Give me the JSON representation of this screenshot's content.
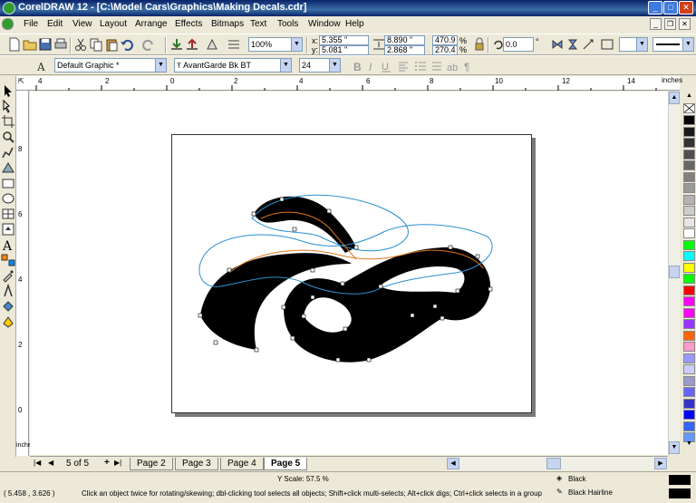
{
  "window": {
    "title": "CorelDRAW 12 - [C:\\Model Cars\\Graphics\\Making Decals.cdr]",
    "controls": [
      "minimize-icon",
      "maximize-icon",
      "close-icon"
    ]
  },
  "menu": {
    "items": [
      "File",
      "Edit",
      "View",
      "Layout",
      "Arrange",
      "Effects",
      "Bitmaps",
      "Text",
      "Tools",
      "Window",
      "Help"
    ]
  },
  "toolbar": {
    "zoom": "100%",
    "x": "5.355 \"",
    "y": "5.081 \"",
    "width": "8.890 \"",
    "height": "2.868 \"",
    "scale_x": "470.9",
    "scale_y": "270.4",
    "pct": "%",
    "rotation": "0.0",
    "degree": "°",
    "x_label": "x:",
    "y_label": "y:"
  },
  "propertybar": {
    "style": "Default Graphic *",
    "font": "AvantGarde Bk BT",
    "size": "24"
  },
  "ruler": {
    "unit": "inches",
    "top_labels": [
      "4",
      "2",
      "0",
      "2",
      "4",
      "6",
      "8",
      "10",
      "12",
      "14"
    ],
    "left_labels": [
      "8",
      "6",
      "4",
      "2",
      "0"
    ],
    "left_unit": "inches"
  },
  "pages": {
    "counter": "5 of 5",
    "tabs": [
      "Page 2",
      "Page 3",
      "Page 4",
      "Page 5"
    ],
    "active": "Page 5"
  },
  "status": {
    "coords": "( 5.458 , 3.626 )",
    "y_scale": "Y Scale: 57.5 %",
    "hint": "Click an object twice for rotating/skewing; dbl-clicking tool selects all objects; Shift+click multi-selects; Alt+click digs; Ctrl+click selects in a group",
    "fill": "Black",
    "outline": "Black  Hairline"
  },
  "palette_colors": [
    "#000000",
    "#1a1a1a",
    "#333333",
    "#4d4d4d",
    "#666666",
    "#808080",
    "#999999",
    "#b3b3b3",
    "#cccccc",
    "#e6e6e6",
    "#ffffff",
    "#00ff00",
    "#00ffff",
    "#ffff00",
    "#00ff00",
    "#ff0000",
    "#ff00ff",
    "#ff00ff",
    "#9933ff",
    "#ff6600",
    "#ff99cc",
    "#9999ff",
    "#ccccff",
    "#9999cc",
    "#6666ff",
    "#3333cc",
    "#0000ff",
    "#3366ff",
    "#6699ff"
  ]
}
